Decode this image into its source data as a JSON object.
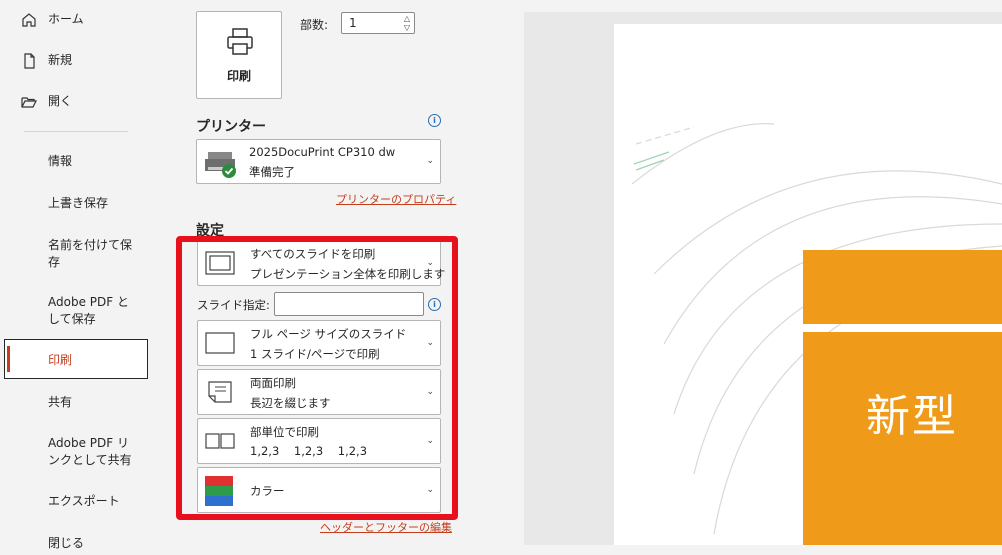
{
  "sidebar": {
    "home": "ホーム",
    "new": "新規",
    "open": "開く",
    "info": "情報",
    "save": "上書き保存",
    "save_as": "名前を付けて保存",
    "adobe_save": "Adobe PDF として保存",
    "print": "印刷",
    "share": "共有",
    "adobe_share": "Adobe PDF リンクとして共有",
    "export": "エクスポート",
    "close": "閉じる"
  },
  "print": {
    "button_label": "印刷",
    "copies_label": "部数:",
    "copies_value": "1"
  },
  "printer": {
    "section_title": "プリンター",
    "name": "2025DocuPrint CP310 dw",
    "status": "準備完了",
    "properties_link": "プリンターのプロパティ"
  },
  "settings": {
    "section_title": "設定",
    "slides_range": {
      "line1": "すべてのスライドを印刷",
      "line2": "プレゼンテーション全体を印刷します"
    },
    "slide_spec_label": "スライド指定:",
    "slide_spec_value": "",
    "layout": {
      "line1": "フル ページ サイズのスライド",
      "line2": "1 スライド/ページで印刷"
    },
    "sides": {
      "line1": "両面印刷",
      "line2": "長辺を綴じます"
    },
    "collate": {
      "line1": "部単位で印刷",
      "line2": "1,2,3    1,2,3    1,2,3"
    },
    "color": {
      "line1": "カラー"
    },
    "header_footer_link": "ヘッダーとフッターの編集"
  },
  "preview": {
    "title_text": "新型"
  },
  "colors": {
    "accent": "#c43e1c",
    "highlight_frame": "#e8101d",
    "slide_orange": "#ef9a18",
    "info_blue": "#2b6cb0"
  }
}
